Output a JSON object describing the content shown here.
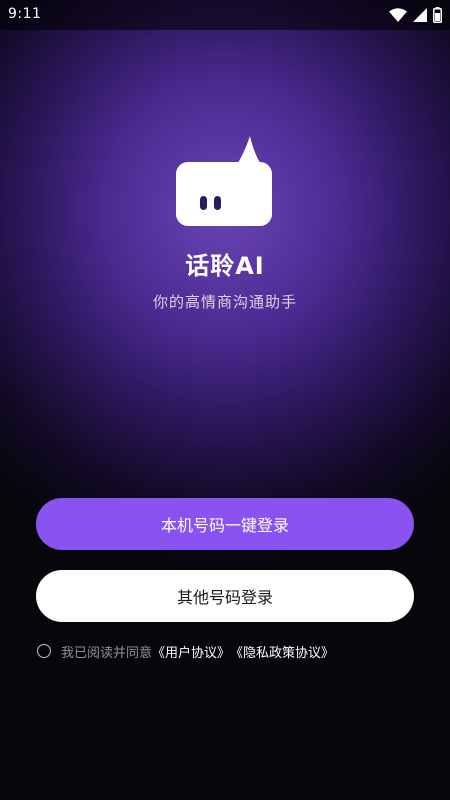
{
  "status_bar": {
    "time": "9:11",
    "icons": [
      "wifi-icon",
      "cellular-signal-icon",
      "battery-icon"
    ]
  },
  "logo": {
    "icon": "chat-bubble-face-logo"
  },
  "app": {
    "name": "话聆AI",
    "tagline": "你的高情商沟通助手"
  },
  "buttons": {
    "one_click_login": "本机号码一键登录",
    "other_number_login": "其他号码登录"
  },
  "agreement": {
    "checked": false,
    "prefix": "我已阅读并同意",
    "user_agreement": "《用户协议》",
    "privacy_policy": "《隐私政策协议》"
  },
  "colors": {
    "primary_button": "#8a52f0",
    "secondary_button": "#ffffff",
    "background_glow": "#6a45b5",
    "background_dark": "#07060b"
  }
}
